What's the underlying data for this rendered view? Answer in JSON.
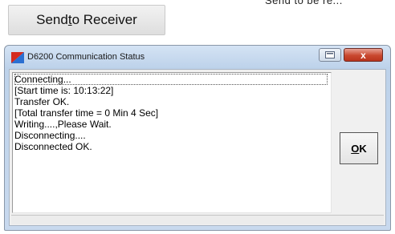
{
  "top_fragment": "Send to be re...",
  "send_button": {
    "before": "Send ",
    "mnemonic": "t",
    "after": "o Receiver"
  },
  "dialog": {
    "title": "D6200 Communication Status",
    "close_glyph": "x",
    "log_lines": [
      "Connecting...",
      "[Start time is: 10:13:22]",
      "Transfer OK.",
      "[Total transfer time = 0 Min 4 Sec]",
      "Writing....,Please Wait.",
      "Disconnecting....",
      "Disconnected OK."
    ],
    "ok_button": {
      "mnemonic": "O",
      "after": "K"
    }
  },
  "colors": {
    "close_red": "#c9482f",
    "window_frame": "#bdd2ea",
    "icon_red": "#d42a1e",
    "icon_blue": "#2b6fd1"
  }
}
